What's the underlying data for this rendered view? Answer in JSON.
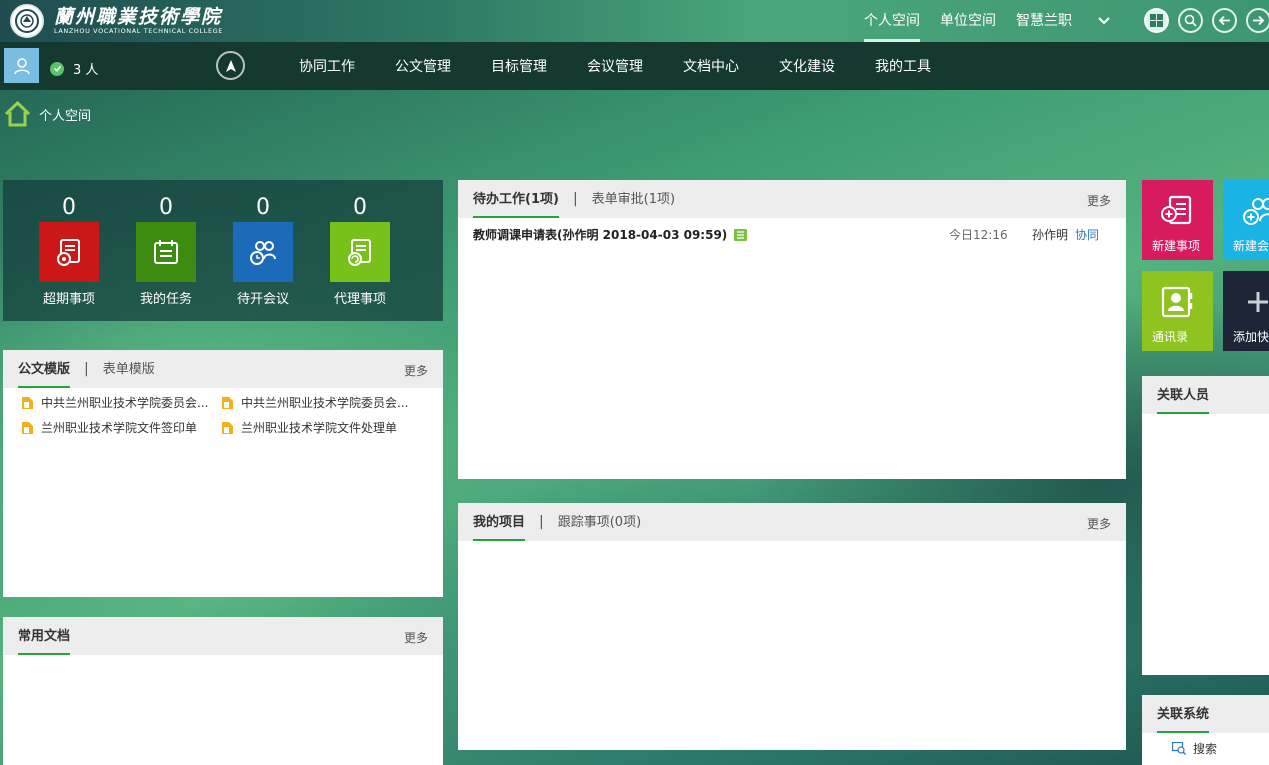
{
  "logo": {
    "name_cn": "蘭州職業技術學院",
    "name_en": "LANZHOU VOCATIONAL TECHNICAL COLLEGE"
  },
  "top_nav": {
    "items": [
      "个人空间",
      "单位空间",
      "智慧兰职"
    ],
    "active_index": 0
  },
  "user_bar": {
    "online_count": "3 人"
  },
  "main_nav": {
    "items": [
      "协同工作",
      "公文管理",
      "目标管理",
      "会议管理",
      "文档中心",
      "文化建设",
      "我的工具"
    ]
  },
  "breadcrumb": {
    "label": "个人空间"
  },
  "stats": [
    {
      "count": "0",
      "label": "超期事项",
      "color": "#cc1717",
      "icon": "overdue-doc-icon"
    },
    {
      "count": "0",
      "label": "我的任务",
      "color": "#3e8b12",
      "icon": "calendar-task-icon"
    },
    {
      "count": "0",
      "label": "待开会议",
      "color": "#1c6bb8",
      "icon": "meeting-people-icon"
    },
    {
      "count": "0",
      "label": "代理事项",
      "color": "#77c11a",
      "icon": "proxy-doc-icon"
    }
  ],
  "templates_panel": {
    "tabs": [
      "公文模版",
      "表单模版"
    ],
    "more": "更多",
    "items": [
      "中共兰州职业技术学院委员会...",
      "中共兰州职业技术学院委员会...",
      "兰州职业技术学院文件签印单",
      "兰州职业技术学院文件处理单"
    ]
  },
  "common_docs_panel": {
    "title": "常用文档",
    "more": "更多"
  },
  "todo_panel": {
    "tabs": [
      "待办工作(1项)",
      "表单审批(1项)"
    ],
    "more": "更多",
    "rows": [
      {
        "title": "教师调课申请表(孙作明 2018-04-03 09:59)",
        "time": "今日12:16",
        "sender": "孙作明",
        "type": "协同"
      }
    ]
  },
  "projects_panel": {
    "tabs": [
      "我的项目",
      "跟踪事项(0项)"
    ],
    "more": "更多"
  },
  "quick_tiles": [
    {
      "label": "新建事项",
      "color": "#d81b5f",
      "icon": "new-item-icon"
    },
    {
      "label": "新建会",
      "color": "#1ab3e6",
      "icon": "new-meeting-icon"
    },
    {
      "label": "通讯录",
      "color": "#8fc31f",
      "icon": "contacts-icon"
    },
    {
      "label": "添加快",
      "color": "#1d2537",
      "icon": "plus-icon"
    }
  ],
  "related_people_panel": {
    "title": "关联人员"
  },
  "related_systems_panel": {
    "title": "关联系统",
    "items": [
      "搜索"
    ]
  }
}
